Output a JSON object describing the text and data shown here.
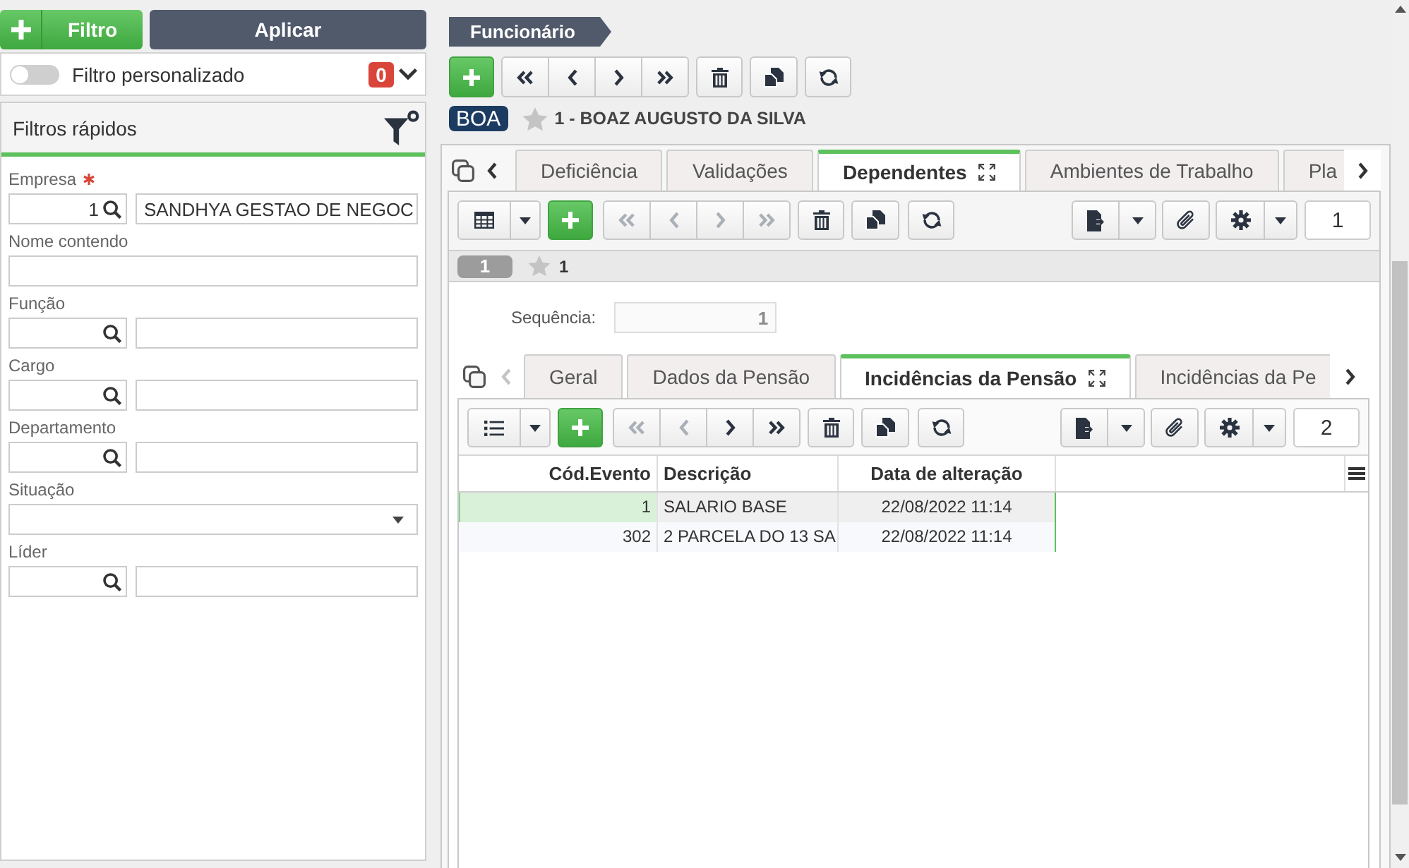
{
  "filter_panel": {
    "add_button": "Filtro",
    "apply_button": "Aplicar",
    "custom_filter": {
      "label": "Filtro personalizado",
      "on": false,
      "count": "0"
    },
    "quick_filters": {
      "title": "Filtros rápidos",
      "fields": [
        {
          "kind": "lookup",
          "label": "Empresa",
          "required": true,
          "code": "1",
          "value": "SANDHYA GESTAO DE NEGOC"
        },
        {
          "kind": "text",
          "label": "Nome contendo",
          "required": false
        },
        {
          "kind": "lookup",
          "label": "Função",
          "required": false
        },
        {
          "kind": "lookup",
          "label": "Cargo",
          "required": false
        },
        {
          "kind": "lookup",
          "label": "Departamento",
          "required": false
        },
        {
          "kind": "select",
          "label": "Situação",
          "required": false
        },
        {
          "kind": "lookup",
          "label": "Líder",
          "required": false
        }
      ]
    }
  },
  "breadcrumb": "Funcionário",
  "toolbar": {
    "nav": [
      {
        "kind": "first",
        "disabled": false
      },
      {
        "kind": "prev",
        "disabled": false
      },
      {
        "kind": "next",
        "disabled": false
      },
      {
        "kind": "last",
        "disabled": false
      }
    ]
  },
  "record": {
    "badge": "BOA",
    "starred": false,
    "title": "1 - BOAZ AUGUSTO DA SILVA"
  },
  "tab_strip": {
    "back_disabled": false,
    "tabs": [
      {
        "label": "Deficiência",
        "selected": false
      },
      {
        "label": "Validações",
        "selected": false
      },
      {
        "label": "Dependentes",
        "selected": true
      },
      {
        "label": "Ambientes de Trabalho",
        "selected": false
      },
      {
        "label": "Pla",
        "selected": false
      }
    ]
  },
  "dependents": {
    "toolbar": {
      "nav": [
        {
          "kind": "first",
          "disabled": true
        },
        {
          "kind": "prev",
          "disabled": true
        },
        {
          "kind": "next",
          "disabled": true
        },
        {
          "kind": "last",
          "disabled": true
        }
      ],
      "page": "1"
    },
    "record": {
      "index": "1",
      "starred": false,
      "title": "1"
    },
    "sequence": {
      "label": "Sequência:",
      "value": "1"
    },
    "tab_strip": {
      "back_disabled": true,
      "tabs": [
        {
          "label": "Geral",
          "selected": false
        },
        {
          "label": "Dados da Pensão",
          "selected": false
        },
        {
          "label": "Incidências da Pensão",
          "selected": true
        },
        {
          "label": "Incidências da Pe",
          "selected": false
        }
      ]
    },
    "incidences": {
      "toolbar": {
        "nav": [
          {
            "kind": "first",
            "disabled": true
          },
          {
            "kind": "prev",
            "disabled": true
          },
          {
            "kind": "next",
            "disabled": false
          },
          {
            "kind": "last",
            "disabled": false
          }
        ],
        "page": "2"
      },
      "table": {
        "columns": [
          "Cód.Evento",
          "Descrição",
          "Data de alteração"
        ],
        "rows": [
          {
            "selected": true,
            "cells": [
              "1",
              "SALARIO BASE",
              "22/08/2022 11:14"
            ]
          },
          {
            "selected": false,
            "cells": [
              "302",
              "2 PARCELA DO 13 SA",
              "22/08/2022 11:14"
            ]
          }
        ]
      }
    }
  }
}
